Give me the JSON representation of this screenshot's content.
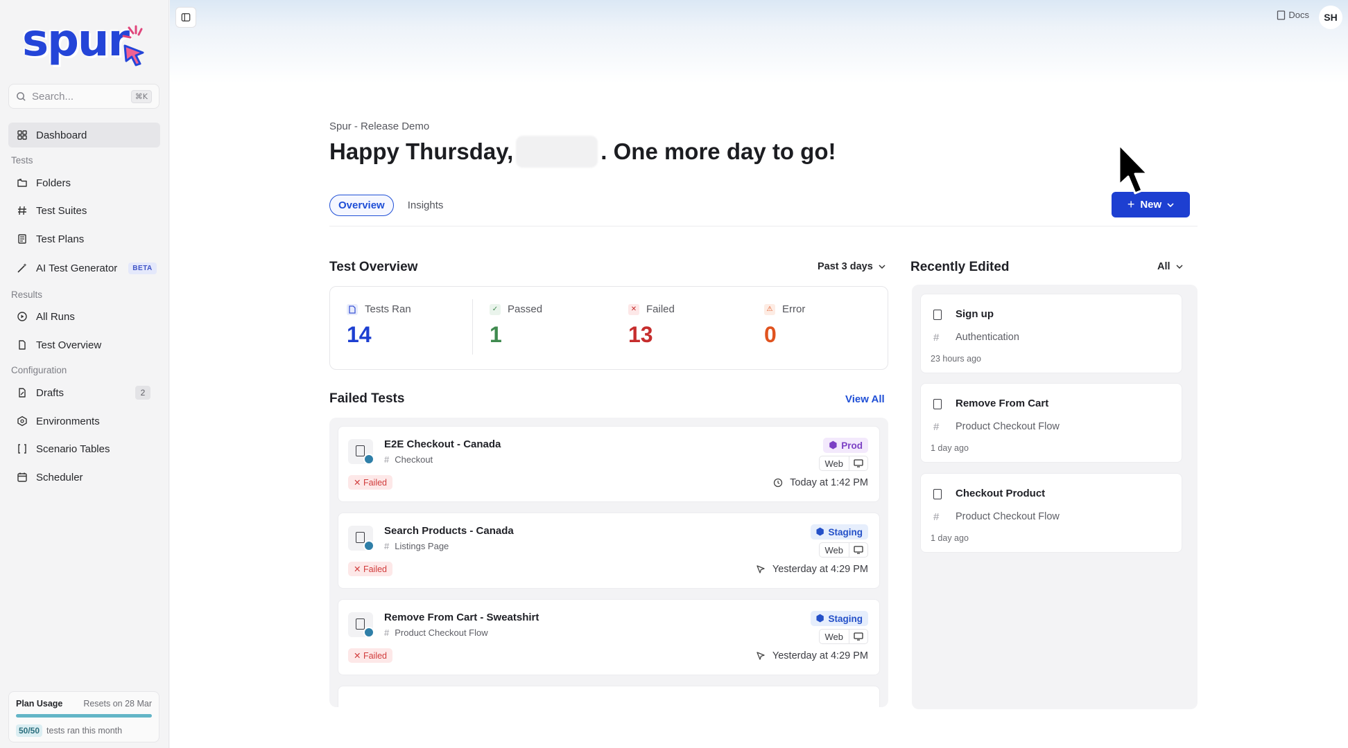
{
  "sidebar": {
    "logo": "spur",
    "search": {
      "placeholder": "Search...",
      "shortcut": "⌘K"
    },
    "dashboard": "Dashboard",
    "sections": {
      "tests": "Tests",
      "results": "Results",
      "configuration": "Configuration"
    },
    "tests_items": [
      "Folders",
      "Test Suites",
      "Test Plans",
      "AI Test Generator"
    ],
    "beta_label": "BETA",
    "results_items": [
      "All Runs",
      "Test Overview"
    ],
    "config_items": [
      "Drafts",
      "Environments",
      "Scenario Tables",
      "Scheduler"
    ],
    "drafts_count": "2",
    "plan": {
      "title": "Plan Usage",
      "resets": "Resets on 28 Mar",
      "usage": "50/50",
      "usage_text": "tests ran this month",
      "fill": 1.0
    }
  },
  "header": {
    "docs": "Docs",
    "avatar": "SH"
  },
  "page": {
    "breadcrumb": "Spur - Release Demo",
    "greeting_start": "Happy Thursday,",
    "greeting_end": ". One more day to go!",
    "tabs": [
      "Overview",
      "Insights"
    ],
    "new_button": "New"
  },
  "test_overview": {
    "title": "Test Overview",
    "range": "Past 3 days",
    "stats": [
      {
        "label": "Tests Ran",
        "value": "14",
        "color": "#1d3fd1"
      },
      {
        "label": "Passed",
        "value": "1",
        "color": "#3f8a4f"
      },
      {
        "label": "Failed",
        "value": "13",
        "color": "#c62d2d"
      },
      {
        "label": "Error",
        "value": "0",
        "color": "#e0531f"
      }
    ]
  },
  "failed_tests": {
    "title": "Failed Tests",
    "view_all": "View All",
    "items": [
      {
        "name": "E2E Checkout - Canada",
        "suite": "Checkout",
        "status": "Failed",
        "env": "Prod",
        "platform": "Web",
        "time": "Today at 1:42 PM"
      },
      {
        "name": "Search Products - Canada",
        "suite": "Listings Page",
        "status": "Failed",
        "env": "Staging",
        "platform": "Web",
        "time": "Yesterday at 4:29 PM"
      },
      {
        "name": "Remove From Cart - Sweatshirt",
        "suite": "Product Checkout Flow",
        "status": "Failed",
        "env": "Staging",
        "platform": "Web",
        "time": "Yesterday at 4:29 PM"
      }
    ]
  },
  "recently_edited": {
    "title": "Recently Edited",
    "filter": "All",
    "items": [
      {
        "name": "Sign up",
        "suite": "Authentication",
        "time": "23 hours ago"
      },
      {
        "name": "Remove From Cart",
        "suite": "Product Checkout Flow",
        "time": "1 day ago"
      },
      {
        "name": "Checkout Product",
        "suite": "Product Checkout Flow",
        "time": "1 day ago"
      }
    ]
  }
}
